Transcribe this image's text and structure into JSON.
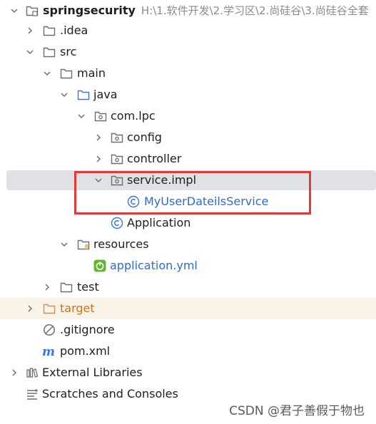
{
  "project": {
    "name": "springsecurity",
    "path": "H:\\1.软件开发\\2.学习区\\2.尚硅谷\\3.尚硅谷全套"
  },
  "tree": {
    "idea": ".idea",
    "src": "src",
    "main": "main",
    "java": "java",
    "package": "com.lpc",
    "config": "config",
    "controller": "controller",
    "service_impl": "service.impl",
    "my_service_class": "MyUserDateilsService",
    "application_class": "Application",
    "resources": "resources",
    "application_yml": "application.yml",
    "test": "test",
    "target": "target",
    "gitignore": ".gitignore",
    "pom": "pom.xml",
    "external_libraries": "External Libraries",
    "scratches": "Scratches and Consoles"
  },
  "icons": {
    "module": "module-folder-icon",
    "folder": "folder-icon",
    "source_folder": "source-folder-icon",
    "package": "package-icon",
    "class": "class-icon",
    "spring_yml": "spring-leaf-icon",
    "ignore": "ignore-file-icon",
    "maven": "maven-icon",
    "libraries": "libraries-icon",
    "scratches": "scratches-icon"
  },
  "colors": {
    "selection": "#dfe1e5",
    "folder_stroke": "#6e6e6e",
    "source_folder_stroke": "#3574f0",
    "target_folder_stroke": "#e08855",
    "class_icon": "#3574f0",
    "spring_green": "#5fb832",
    "highlight_red": "#e53935"
  },
  "watermark": "CSDN @君子善假于物也"
}
